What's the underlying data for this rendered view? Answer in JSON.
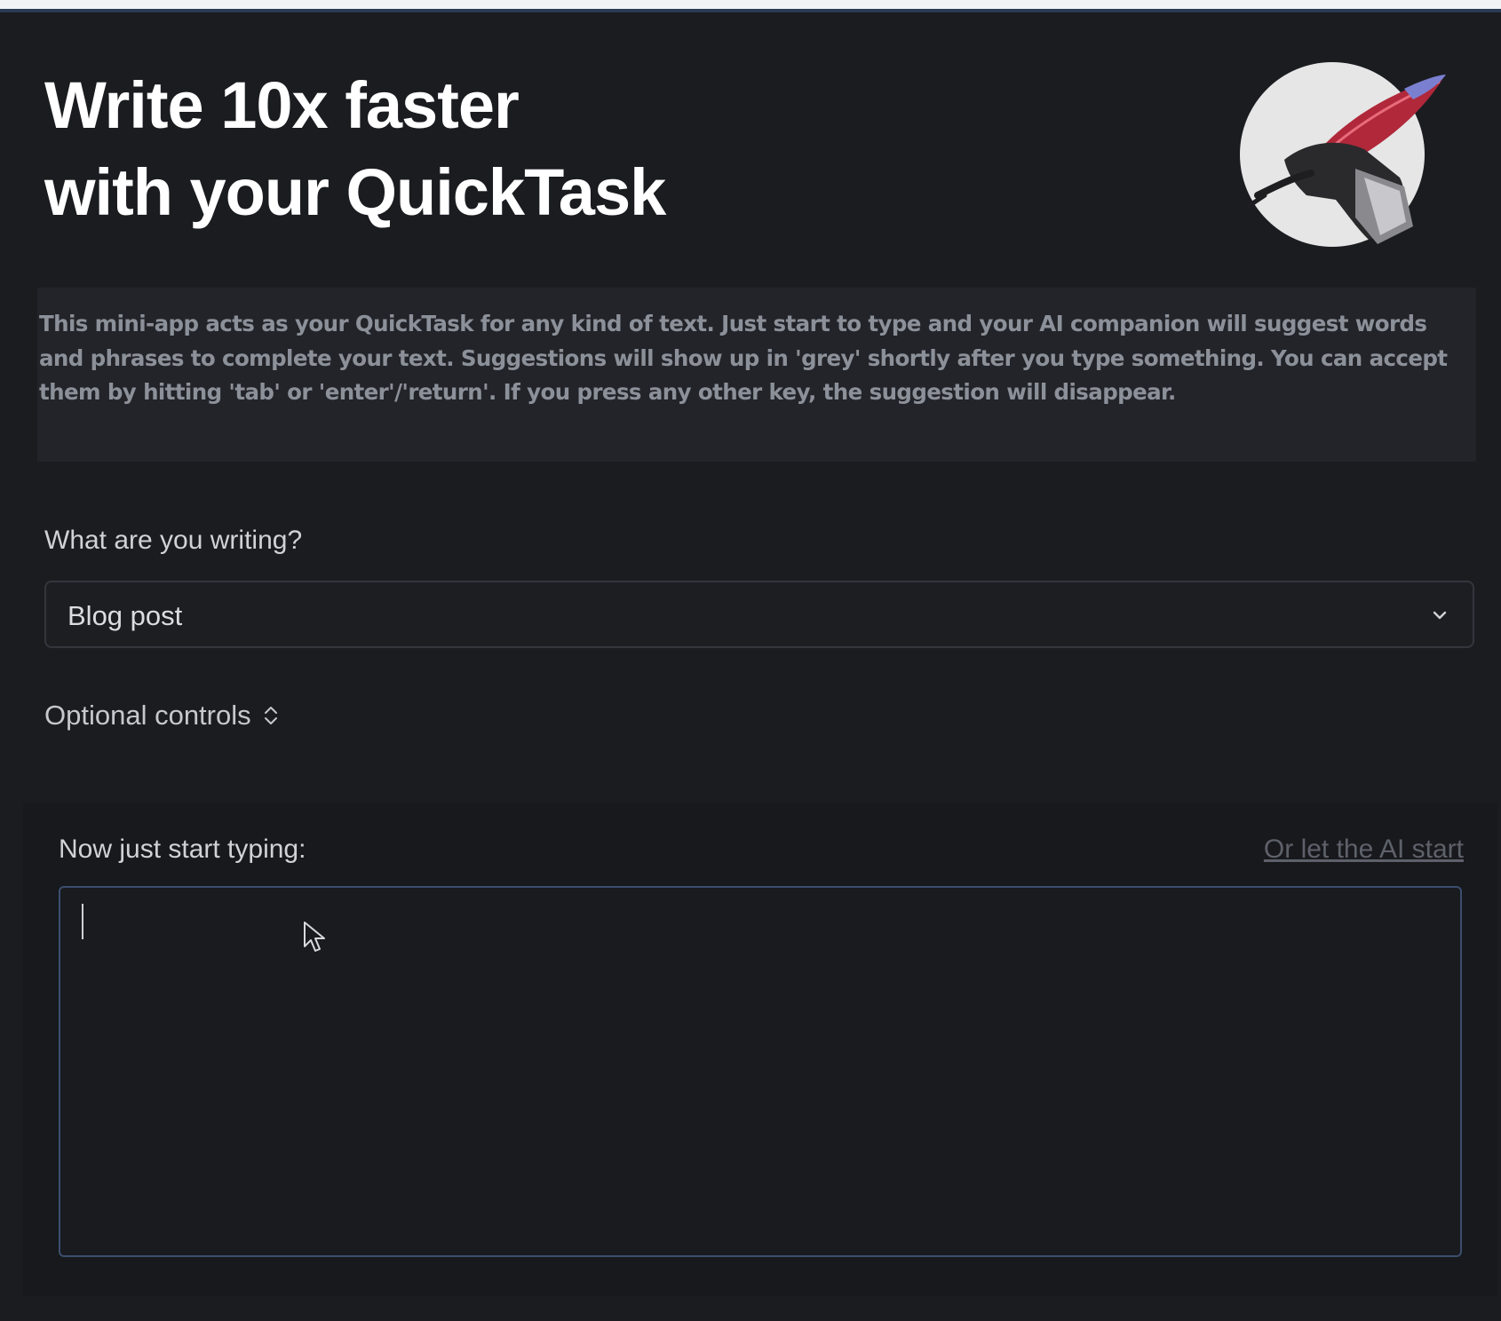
{
  "header": {
    "title_line1": "Write 10x faster",
    "title_line2": "with your QuickTask",
    "logo_icon": "quill-hand-icon"
  },
  "description": "This mini-app acts as your QuickTask for any kind of text. Just start to type and your AI companion will suggest words and phrases to complete your text. Suggestions will show up in 'grey' shortly after you type something. You can accept them by hitting 'tab' or 'enter'/'return'. If you press any other key, the suggestion will disappear.",
  "form": {
    "writing_label": "What are you writing?",
    "writing_selected": "Blog post",
    "optional_controls_label": "Optional controls"
  },
  "editor": {
    "prompt_label": "Now just start typing:",
    "ai_start_link": "Or let the AI start",
    "text_value": "",
    "placeholder": ""
  },
  "colors": {
    "background": "#1b1c20",
    "accent_border": "#3b4e6e",
    "muted_text": "#8c9099"
  }
}
